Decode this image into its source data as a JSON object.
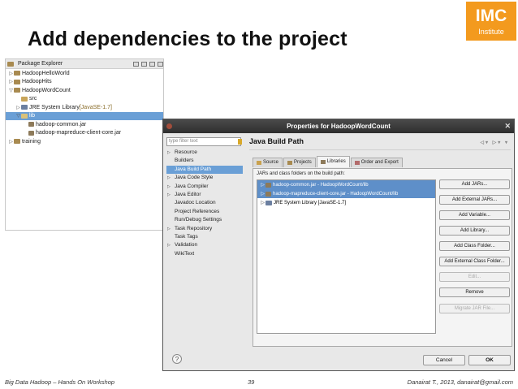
{
  "slide": {
    "title": "Add dependencies to the project",
    "logo_main": "IMC",
    "logo_sub": "Institute"
  },
  "package_explorer": {
    "title": "Package Explorer",
    "tree": [
      {
        "label": "HadoopHelloWorld",
        "indent": 0,
        "twisty": "▷",
        "icon": "project"
      },
      {
        "label": "HadoopHits",
        "indent": 0,
        "twisty": "▷",
        "icon": "project"
      },
      {
        "label": "HadoopWordCount",
        "indent": 0,
        "twisty": "▽",
        "icon": "project"
      },
      {
        "label": "src",
        "indent": 1,
        "twisty": "",
        "icon": "src"
      },
      {
        "label": "JRE System Library",
        "suffix": "[JavaSE-1.7]",
        "indent": 1,
        "twisty": "▷",
        "icon": "jre"
      },
      {
        "label": "lib",
        "indent": 1,
        "twisty": "▽",
        "icon": "lib",
        "selected": true
      },
      {
        "label": "hadoop-common.jar",
        "indent": 2,
        "twisty": "",
        "icon": "jar"
      },
      {
        "label": "hadoop-mapreduce-client-core.jar",
        "indent": 2,
        "twisty": "",
        "icon": "jar"
      },
      {
        "label": "training",
        "indent": 0,
        "twisty": "▷",
        "icon": "project"
      }
    ]
  },
  "dialog": {
    "title": "Properties for HadoopWordCount",
    "filter_placeholder": "type filter text",
    "page_title": "Java Build Path",
    "nav_items": [
      {
        "label": "Resource",
        "arrow": true
      },
      {
        "label": "Builders",
        "arrow": false
      },
      {
        "label": "Java Build Path",
        "arrow": false,
        "selected": true
      },
      {
        "label": "Java Code Style",
        "arrow": true
      },
      {
        "label": "Java Compiler",
        "arrow": true
      },
      {
        "label": "Java Editor",
        "arrow": true
      },
      {
        "label": "Javadoc Location",
        "arrow": false
      },
      {
        "label": "Project References",
        "arrow": false
      },
      {
        "label": "Run/Debug Settings",
        "arrow": false
      },
      {
        "label": "Task Repository",
        "arrow": true
      },
      {
        "label": "Task Tags",
        "arrow": false
      },
      {
        "label": "Validation",
        "arrow": true
      },
      {
        "label": "WikiText",
        "arrow": false
      }
    ],
    "tabs": [
      {
        "label": "Source",
        "active": false
      },
      {
        "label": "Projects",
        "active": false
      },
      {
        "label": "Libraries",
        "active": true
      },
      {
        "label": "Order and Export",
        "active": false
      }
    ],
    "section_label": "JARs and class folders on the build path:",
    "jars": [
      {
        "label": "hadoop-common.jar - HadoopWordCount/lib",
        "selected": true
      },
      {
        "label": "hadoop-mapreduce-client-core.jar - HadoopWordCount/lib",
        "selected": true
      },
      {
        "label": "JRE System Library [JavaSE-1.7]",
        "selected": false
      }
    ],
    "buttons": [
      {
        "label": "Add JARs...",
        "disabled": false
      },
      {
        "label": "Add External JARs...",
        "disabled": false
      },
      {
        "label": "Add Variable...",
        "disabled": false
      },
      {
        "label": "Add Library...",
        "disabled": false
      },
      {
        "label": "Add Class Folder...",
        "disabled": false
      },
      {
        "label": "Add External Class Folder...",
        "disabled": false
      },
      {
        "label": "Edit...",
        "disabled": true
      },
      {
        "label": "Remove",
        "disabled": false
      },
      {
        "label": "Migrate JAR File...",
        "disabled": true
      }
    ],
    "help": "?",
    "cancel_label": "Cancel",
    "ok_label": "OK"
  },
  "footer": {
    "left": "Big Data Hadoop – Hands On Workshop",
    "center": "39",
    "right": "Danairat T., 2013, danairat@gmail.com"
  }
}
